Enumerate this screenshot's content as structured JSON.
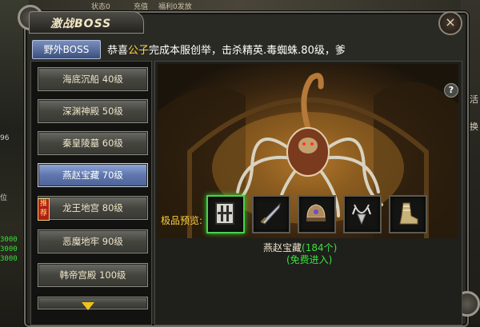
{
  "top_bar": {
    "left_text": "状态0",
    "mid_text": "充值",
    "right_text": "福利0发放"
  },
  "left_hud": {
    "numbers": [
      "3000",
      "3000",
      "3000"
    ],
    "labels": [
      "96",
      "位"
    ]
  },
  "right_hud": {
    "labels": [
      "活",
      "换"
    ]
  },
  "window": {
    "title": "激战BOSS",
    "close_symbol": "×"
  },
  "tab_button": {
    "label": "野外BOSS"
  },
  "announcement": {
    "prefix": "恭喜",
    "player": "公子",
    "suffix": "完成本服创举，击杀精英.毒蜘蛛.80级，爹"
  },
  "recommend_badge": "推荐",
  "boss_list": [
    {
      "label": "海底沉船 40级",
      "selected": false
    },
    {
      "label": "深渊神殿 50级",
      "selected": false
    },
    {
      "label": "秦皇陵墓 60级",
      "selected": false
    },
    {
      "label": "燕赵宝藏 70级",
      "selected": true
    },
    {
      "label": "龙王地宫 80级",
      "selected": false
    },
    {
      "label": "恶魔地牢 90级",
      "selected": false
    },
    {
      "label": "韩帝宫殿 100级",
      "selected": false
    }
  ],
  "help_symbol": "?",
  "preview": {
    "label": "极品预览:",
    "items": [
      {
        "icon": "armor-icon",
        "active": true
      },
      {
        "icon": "sword-icon",
        "active": false
      },
      {
        "icon": "helmet-icon",
        "active": false
      },
      {
        "icon": "necklace-icon",
        "active": false
      },
      {
        "icon": "boots-icon",
        "active": false
      }
    ]
  },
  "selected_map": {
    "name": "燕赵宝藏",
    "count_text": "(184个)",
    "entry_text": "(免费进入)"
  },
  "colors": {
    "highlight_yellow": "#ffd23a",
    "free_green": "#3ae23e",
    "selected_blue": "#5f77ad"
  }
}
